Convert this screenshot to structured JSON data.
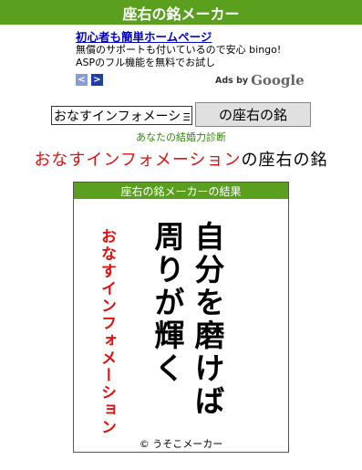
{
  "header": {
    "title": "座右の銘メーカー"
  },
  "ad": {
    "title": "初心者も簡単ホームページ",
    "line1": "無償のサポートも付いているので安心 bingo!",
    "line2": "ASPのフル機能を無料でお試し",
    "prev_icon": "chevron-left-icon",
    "next_icon": "chevron-right-icon",
    "prev_glyph": "<",
    "next_glyph": ">",
    "ads_by": "Ads by",
    "google": "Google"
  },
  "form": {
    "name_value": "おなすインフォメーション",
    "submit_label": "の座右の銘"
  },
  "diagnosis_link": "あなたの結婚力診断",
  "result": {
    "name": "おなすインフォメーション",
    "suffix": "の座右の銘",
    "card_title": "座右の銘メーカーの結果",
    "motto_line1": "自分を磨けば",
    "motto_line2": "周りが輝く",
    "card_name": "おなすインフォメーション",
    "copyright": "© うそこメーカー"
  },
  "colors": {
    "header_bg": "#5aa01e",
    "accent_red": "#e01010",
    "link_blue": "#0000cc"
  }
}
